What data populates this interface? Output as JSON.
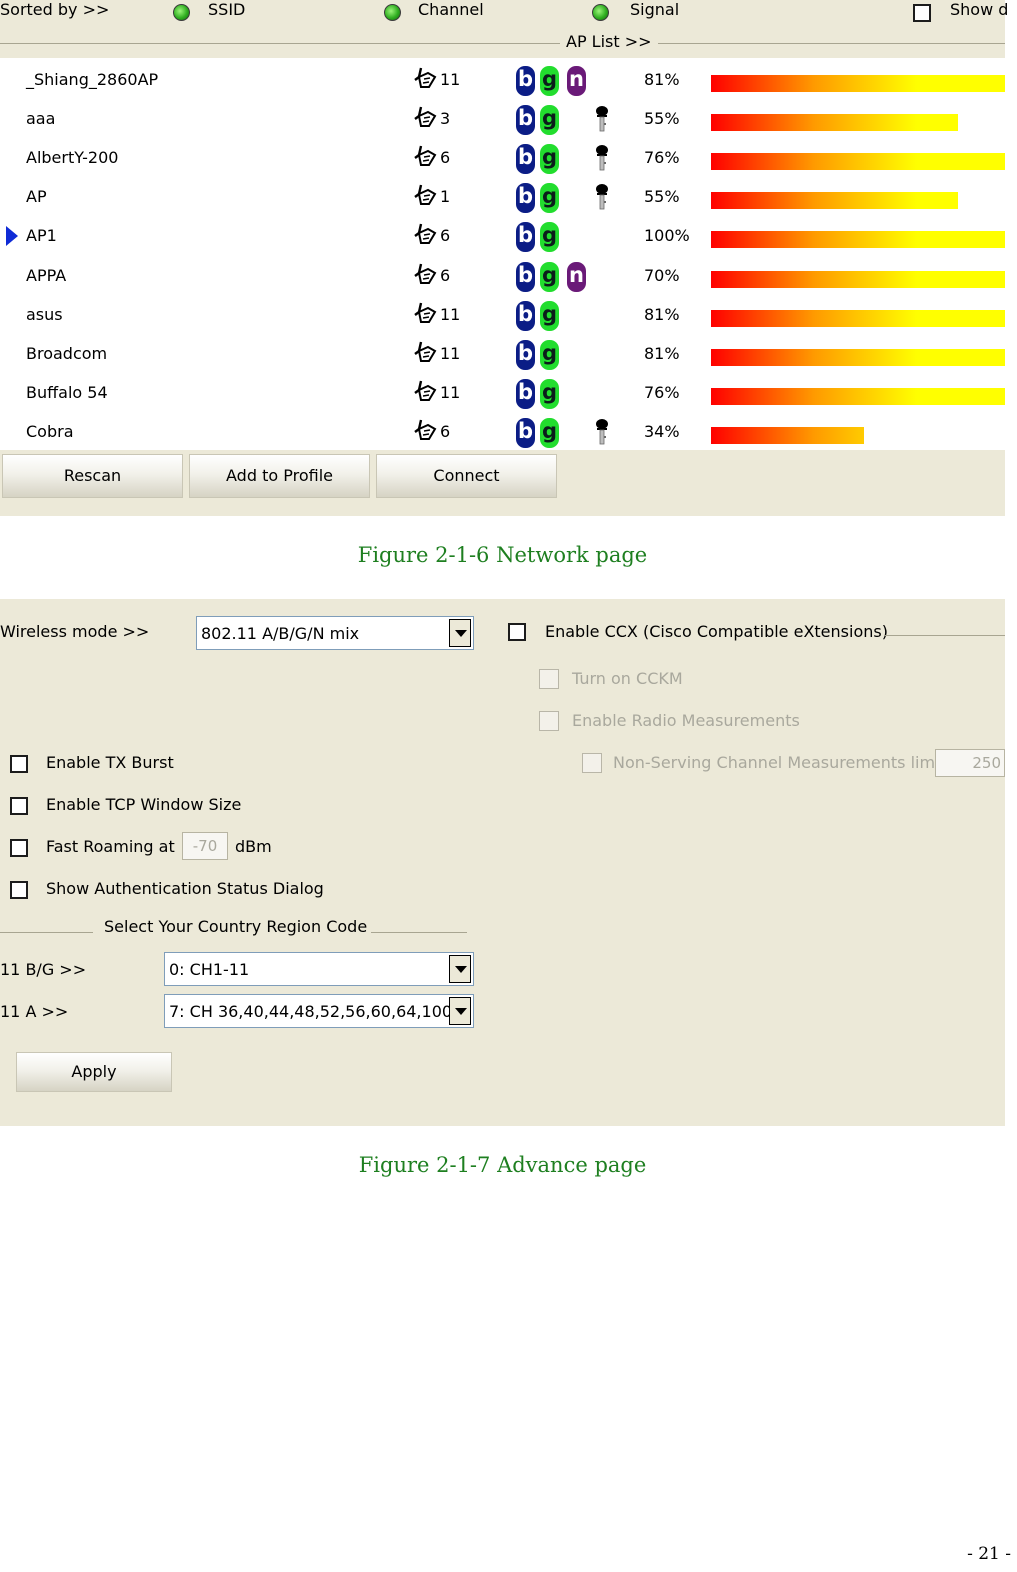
{
  "network": {
    "sort_label": "Sorted by >>",
    "sort_ssid": "SSID",
    "sort_channel": "Channel",
    "sort_signal": "Signal",
    "show_label": "Show d",
    "ap_list_label": "AP List >>",
    "rows": [
      {
        "ssid": "_Shiang_2860AP",
        "channel": "11",
        "b": "b",
        "g": "g",
        "n": "n",
        "secure": false,
        "signal": "81%",
        "signal_frac": 1.0,
        "selected": false
      },
      {
        "ssid": "aaa",
        "channel": "3",
        "b": "b",
        "g": "g",
        "n": "",
        "secure": true,
        "signal": "55%",
        "signal_frac": 0.84,
        "selected": false
      },
      {
        "ssid": "AlbertY-200",
        "channel": "6",
        "b": "b",
        "g": "g",
        "n": "",
        "secure": true,
        "signal": "76%",
        "signal_frac": 1.0,
        "selected": false
      },
      {
        "ssid": "AP",
        "channel": "1",
        "b": "b",
        "g": "g",
        "n": "",
        "secure": true,
        "signal": "55%",
        "signal_frac": 0.84,
        "selected": false
      },
      {
        "ssid": "AP1",
        "channel": "6",
        "b": "b",
        "g": "g",
        "n": "",
        "secure": false,
        "signal": "100%",
        "signal_frac": 1.0,
        "selected": true
      },
      {
        "ssid": "APPA",
        "channel": "6",
        "b": "b",
        "g": "g",
        "n": "n",
        "secure": false,
        "signal": "70%",
        "signal_frac": 1.0,
        "selected": false
      },
      {
        "ssid": "asus",
        "channel": "11",
        "b": "b",
        "g": "g",
        "n": "",
        "secure": false,
        "signal": "81%",
        "signal_frac": 1.0,
        "selected": false
      },
      {
        "ssid": "Broadcom",
        "channel": "11",
        "b": "b",
        "g": "g",
        "n": "",
        "secure": false,
        "signal": "81%",
        "signal_frac": 1.0,
        "selected": false
      },
      {
        "ssid": "Buffalo 54",
        "channel": "11",
        "b": "b",
        "g": "g",
        "n": "",
        "secure": false,
        "signal": "76%",
        "signal_frac": 1.0,
        "selected": false
      },
      {
        "ssid": "Cobra",
        "channel": "6",
        "b": "b",
        "g": "g",
        "n": "",
        "secure": true,
        "signal": "34%",
        "signal_frac": 0.52,
        "selected": false
      }
    ],
    "buttons": {
      "rescan": "Rescan",
      "add_profile": "Add to Profile",
      "connect": "Connect"
    }
  },
  "caption_network": "Figure 2-1-6 Network page",
  "advance": {
    "wireless_mode_label": "Wireless mode >>",
    "wireless_mode_value": "802.11 A/B/G/N mix",
    "ccx_label": "Enable CCX (Cisco Compatible eXtensions)",
    "cckm_label": "Turn on CCKM",
    "radio_meas_label": "Enable Radio Measurements",
    "non_serving_label": "Non-Serving Channel Measurements limit",
    "non_serving_value": "250",
    "tx_burst_label": "Enable TX Burst",
    "tcp_window_label": "Enable TCP Window Size",
    "fast_roaming_label": "Fast Roaming at",
    "fast_roaming_value": "-70",
    "fast_roaming_unit": "dBm",
    "auth_dialog_label": "Show Authentication Status Dialog",
    "country_label": "Select Your Country Region Code",
    "bg_label": "11 B/G >>",
    "bg_value": "0: CH1-11",
    "a_label": "11 A >>",
    "a_value": "7: CH 36,40,44,48,52,56,60,64,100",
    "apply_label": "Apply"
  },
  "caption_advance": "Figure 2-1-7 Advance page",
  "page_number": "- 21 -",
  "colors": {
    "panel": "#ece9d8",
    "caption": "#1e7f20",
    "bar_start": "#ff0000",
    "bar_end": "#ffff00"
  }
}
